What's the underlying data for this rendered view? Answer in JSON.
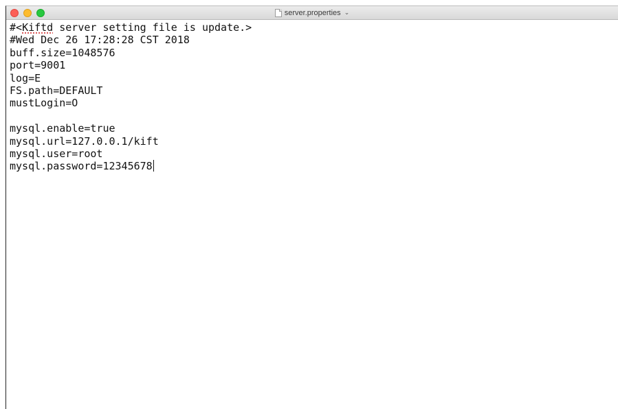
{
  "window": {
    "filename": "server.properties",
    "chevron": "⌄"
  },
  "editor": {
    "line1_prefix": "#<",
    "line1_word": "Kiftd",
    "line1_rest": " server setting file is update.>",
    "lines": [
      "#Wed Dec 26 17:28:28 CST 2018",
      "buff.size=1048576",
      "port=9001",
      "log=E",
      "FS.path=DEFAULT",
      "mustLogin=O",
      "",
      "mysql.enable=true",
      "mysql.url=127.0.0.1/kift",
      "mysql.user=root",
      "mysql.password=12345678"
    ]
  }
}
